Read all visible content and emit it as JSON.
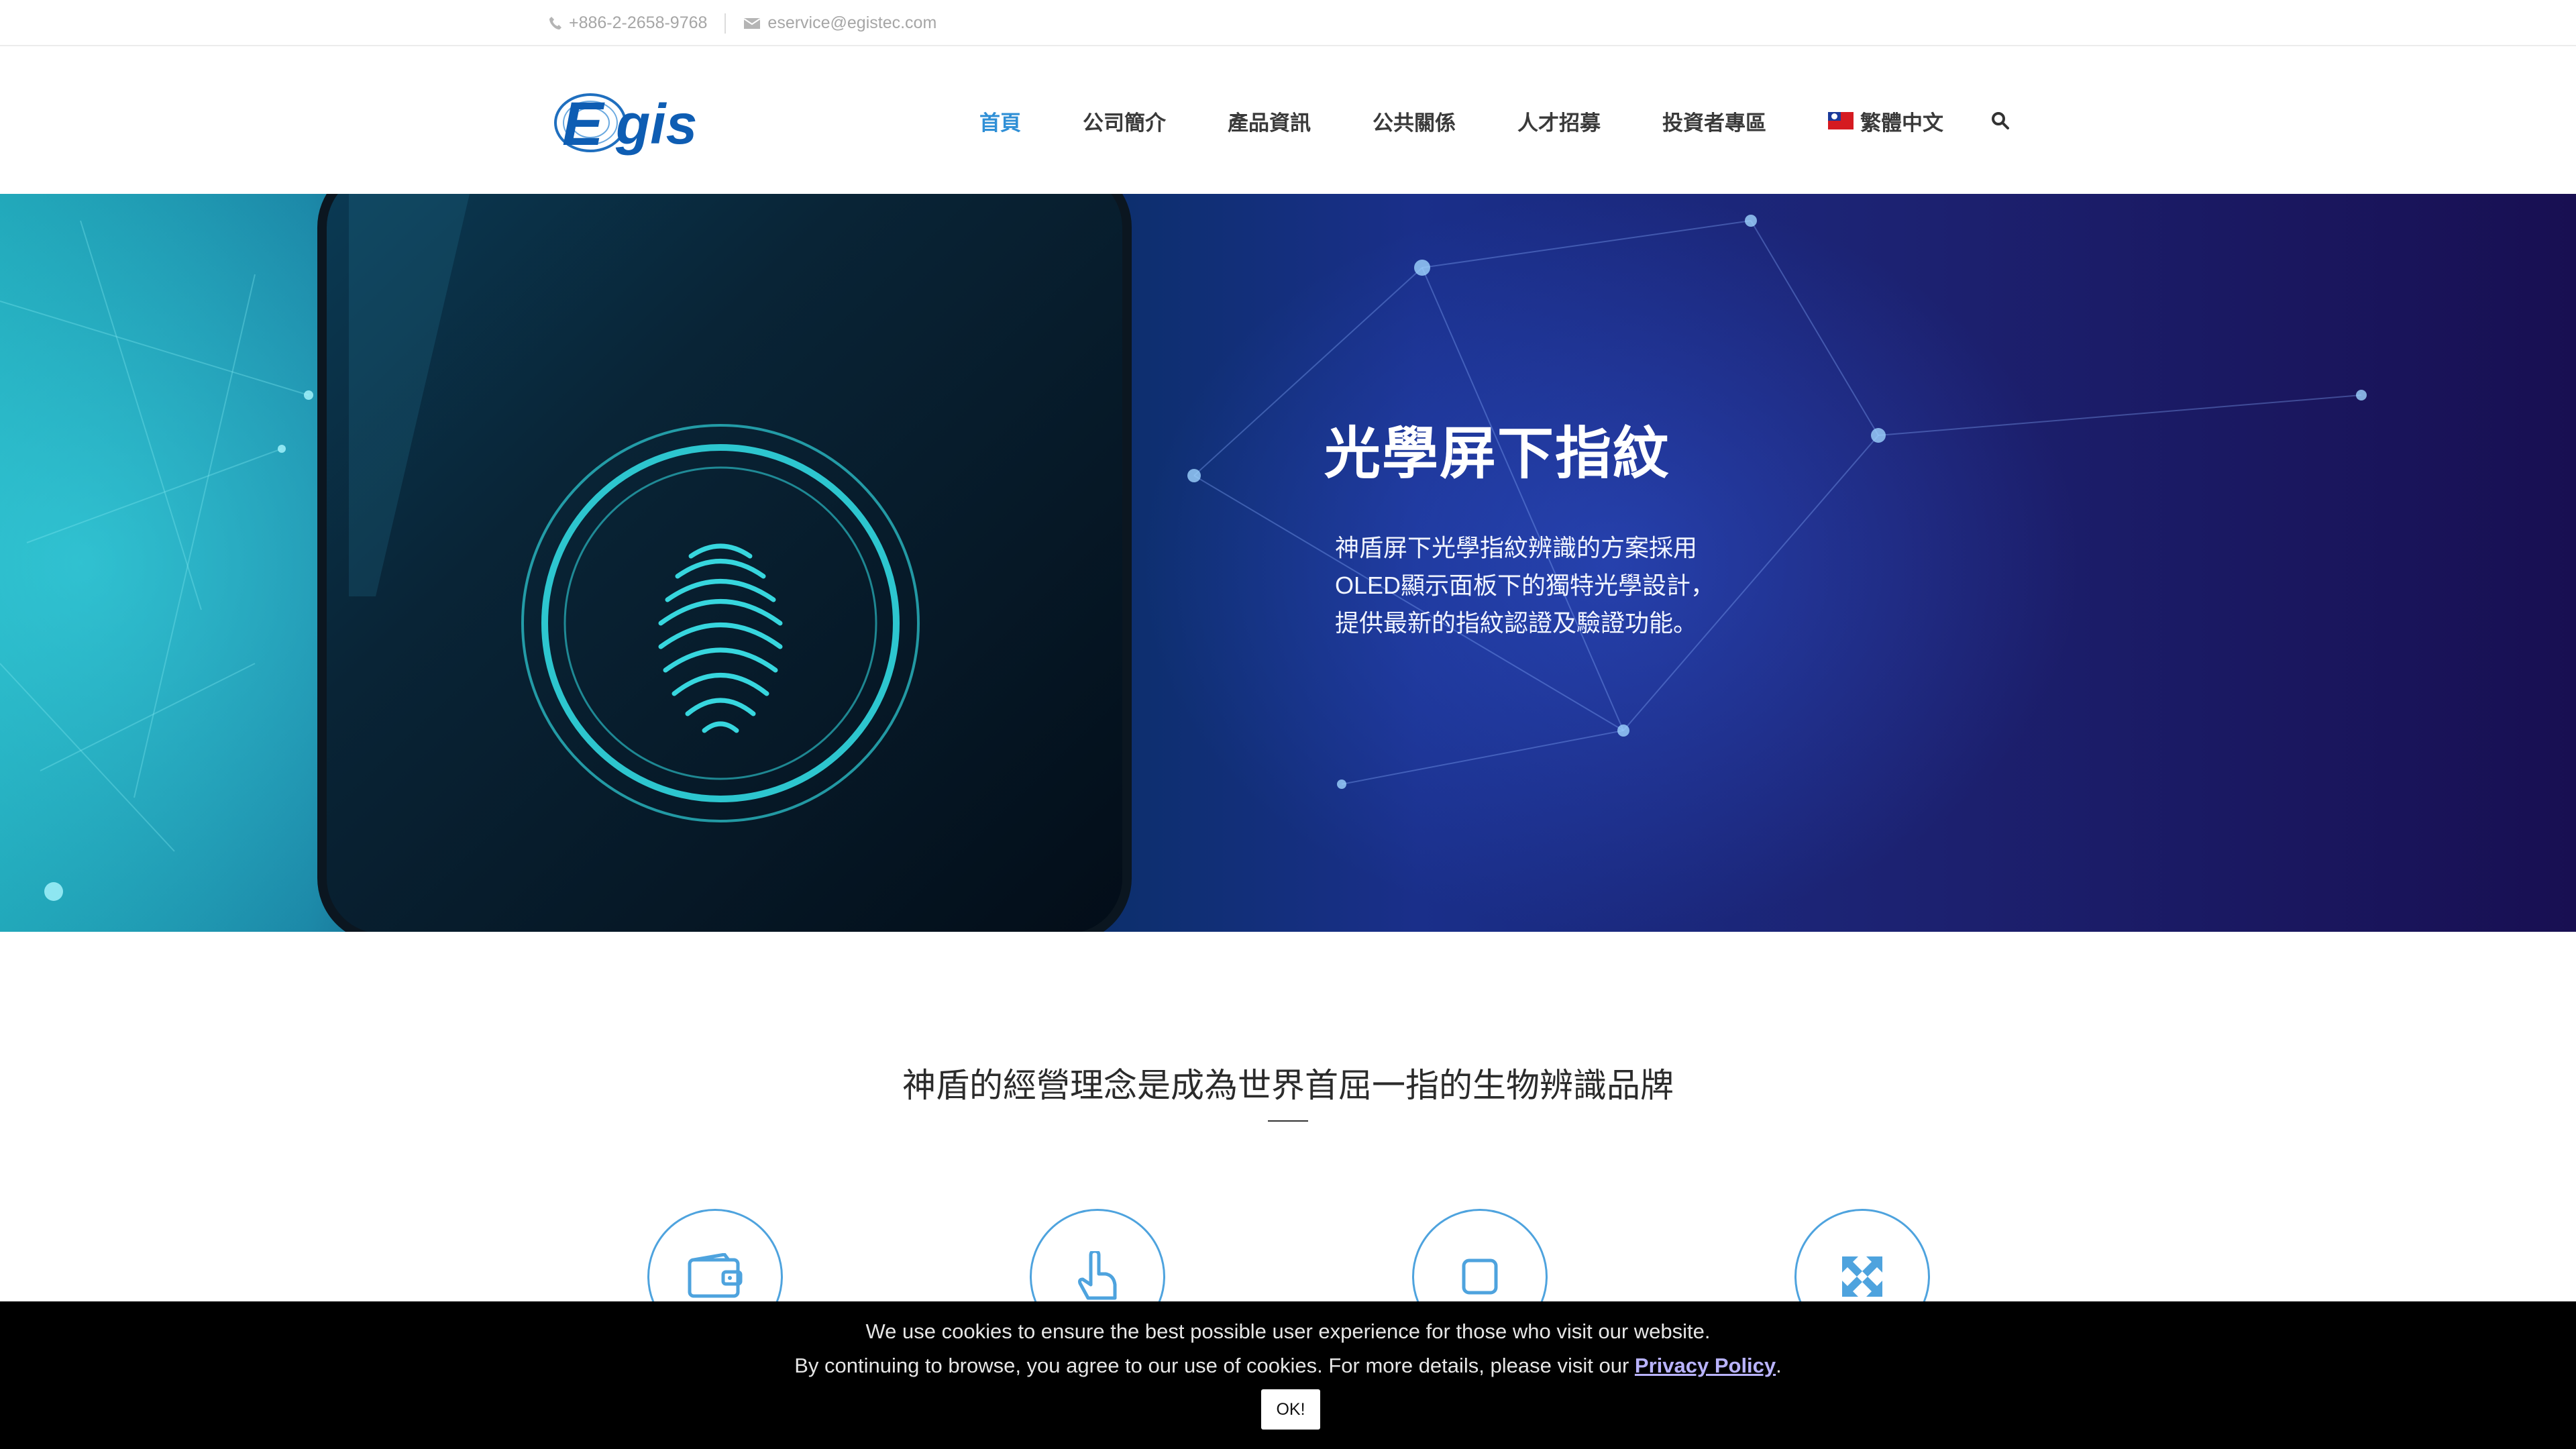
{
  "topbar": {
    "phone": "+886-2-2658-9768",
    "email": "eservice@egistec.com"
  },
  "logo": {
    "text": "Egis"
  },
  "nav": {
    "items": [
      "首頁",
      "公司簡介",
      "產品資訊",
      "公共關係",
      "人才招募",
      "投資者專區"
    ],
    "language": "繁體中文"
  },
  "hero": {
    "title": "光學屏下指紋",
    "desc_line1": "神盾屏下光學指紋辨識的方案採用",
    "desc_line2": "OLED顯示面板下的獨特光學設計，",
    "desc_line3": "提供最新的指紋認證及驗證功能。"
  },
  "intro": {
    "title": "神盾的經營理念是成為世界首屈一指的生物辨識品牌"
  },
  "features": [
    {
      "icon": "wallet-icon"
    },
    {
      "icon": "touch-hand-icon"
    },
    {
      "icon": "square-icon"
    },
    {
      "icon": "expand-arrows-icon"
    }
  ],
  "cookie": {
    "line1": "We use cookies to ensure the best possible user experience for those who visit our website.",
    "line2_prefix": "By continuing to browse, you agree to our use of cookies. For more details, please visit our ",
    "policy_link": "Privacy Policy",
    "line2_suffix": ".",
    "ok": "OK!"
  },
  "colors": {
    "accent": "#2f8fd6",
    "nav_text": "#3a3a3a",
    "cookie_bg": "#000000",
    "icon_ring": "#4ea3de"
  }
}
